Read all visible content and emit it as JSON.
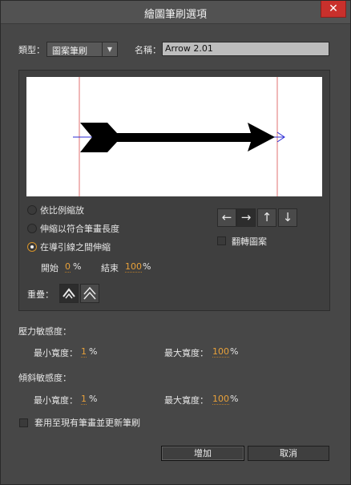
{
  "window": {
    "title": "繪圖筆刷選項",
    "close_glyph": "✕"
  },
  "type": {
    "label": "類型：",
    "value": "圖案筆刷"
  },
  "name": {
    "label": "名稱：",
    "value": "Arrow 2.01"
  },
  "scale_options": [
    {
      "label": "依比例縮放",
      "selected": false
    },
    {
      "label": "伸縮以符合筆畫長度",
      "selected": false
    },
    {
      "label": "在導引線之間伸縮",
      "selected": true
    }
  ],
  "guides": {
    "start_label": "開始",
    "start_value": "0",
    "end_label": "結束",
    "end_value": "100",
    "unit": "%"
  },
  "direction_buttons": [
    {
      "name": "arrow-left-icon",
      "glyph": "←",
      "active": false
    },
    {
      "name": "arrow-right-icon",
      "glyph": "→",
      "active": true
    },
    {
      "name": "arrow-up-icon",
      "glyph": "↑",
      "active": false
    },
    {
      "name": "arrow-down-icon",
      "glyph": "↓",
      "active": false
    }
  ],
  "flip": {
    "label": "翻轉圖案",
    "checked": false
  },
  "overlap": {
    "label": "重疊："
  },
  "pressure": {
    "label": "壓力敏感度：",
    "min_label": "最小寬度：",
    "min_value": "1",
    "max_label": "最大寬度：",
    "max_value": "100",
    "unit": "%"
  },
  "tilt": {
    "label": "傾斜敏感度：",
    "min_label": "最小寬度：",
    "min_value": "1",
    "max_label": "最大寬度：",
    "max_value": "100",
    "unit": "%"
  },
  "apply_existing": {
    "label": "套用至現有筆畫並更新筆刷",
    "checked": false
  },
  "buttons": {
    "add": "增加",
    "cancel": "取消"
  },
  "colors": {
    "accent": "#e8a13a",
    "guide_line": "#e07070",
    "stroke_line": "#2b2bd6"
  }
}
